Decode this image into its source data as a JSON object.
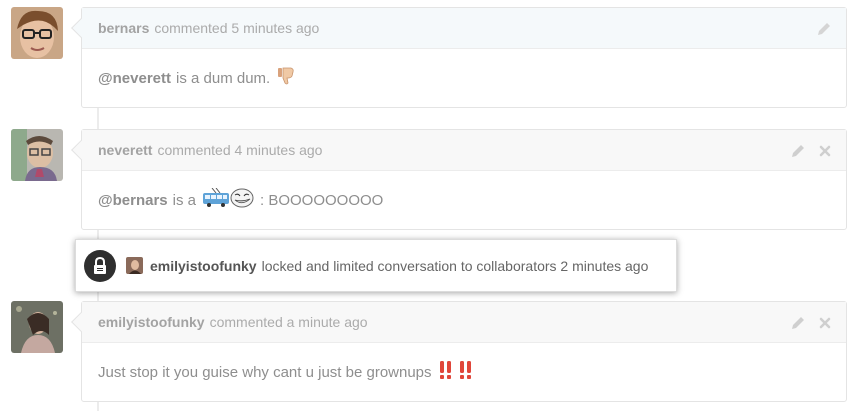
{
  "comments": [
    {
      "author": "bernars",
      "meta": "commented 5 minutes ago",
      "mention": "@neverett",
      "text": "is a dum dum.",
      "emoji": "thumbs-down",
      "actions": [
        "edit"
      ]
    },
    {
      "author": "neverett",
      "meta": "commented 4 minutes ago",
      "mention": "@bernars",
      "text": "is a",
      "emoji": "trolleybus-trollface",
      "after_text": ": BOOOOOOOOO",
      "actions": [
        "edit",
        "delete"
      ]
    },
    {
      "author": "emilyistoofunky",
      "meta": "commented a minute ago",
      "text": "Just stop it you guise why cant u just be grownups",
      "emoji": "double-exclamation",
      "actions": [
        "edit",
        "delete"
      ]
    }
  ],
  "lock_event": {
    "actor": "emilyistoofunky",
    "text": "locked and limited conversation to collaborators 2 minutes ago",
    "icon": "lock-icon"
  },
  "colors": {
    "exclamation": "#e0463a",
    "lock_bg": "#2f2f2f",
    "timeline": "#ececec"
  }
}
